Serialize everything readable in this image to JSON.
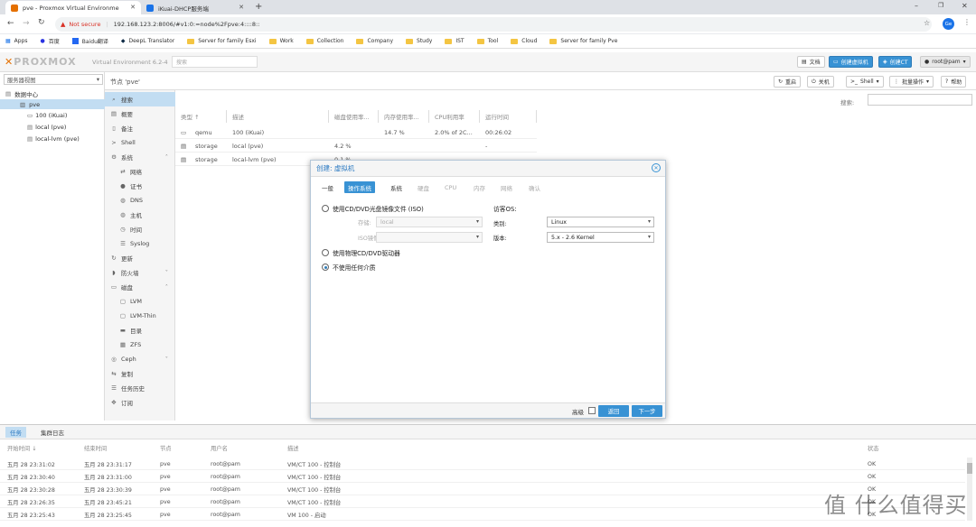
{
  "browser": {
    "tabs": [
      {
        "title": "pve - Proxmox Virtual Environme"
      },
      {
        "title": "iKuai-DHCP服务端"
      }
    ],
    "address": {
      "security": "Not secure",
      "url": "192.168.123.2:8006/#v1:0:=node%2Fpve:4::::8::"
    },
    "profile": "Ge",
    "bookmarks": [
      "Apps",
      "百度",
      "Baidu翻译",
      "DeepL Translator",
      "Server for family Esxi",
      "Work",
      "Collection",
      "Company",
      "Study",
      "IST",
      "Tool",
      "Cloud",
      "Server for family Pve"
    ]
  },
  "pve": {
    "logo": "PROXMOX",
    "version": "Virtual Environment 6.2-4",
    "search_placeholder": "搜索",
    "header_buttons": {
      "docs": "文档",
      "create_vm": "创建虚拟机",
      "create_ct": "创建CT",
      "user": "root@pam"
    },
    "tree": {
      "view_select": "服务器视图",
      "datacenter": "数据中心",
      "node": "pve",
      "children": [
        "100 (iKuai)",
        "local (pve)",
        "local-lvm (pve)"
      ]
    },
    "node_title": "节点 'pve'",
    "node_buttons": {
      "reboot": "重启",
      "shutdown": "关机",
      "shell": "Shell",
      "bulk": "批量操作",
      "help": "帮助"
    },
    "search_label": "搜索:",
    "nav": [
      "搜索",
      "概要",
      "备注",
      "Shell",
      "系统",
      "网络",
      "证书",
      "DNS",
      "主机",
      "时间",
      "Syslog",
      "更新",
      "防火墙",
      "磁盘",
      "LVM",
      "LVM-Thin",
      "目录",
      "ZFS",
      "Ceph",
      "复制",
      "任务历史",
      "订阅"
    ],
    "table": {
      "headers": [
        "类型 ↑",
        "描述",
        "磁盘使用率...",
        "内存使用率...",
        "CPU利用率",
        "运行时间"
      ],
      "rows": [
        {
          "type": "qemu",
          "desc": "100 (iKuai)",
          "disk": "",
          "mem": "14.7 %",
          "cpu": "2.0% of 2C...",
          "uptime": "00:26:02"
        },
        {
          "type": "storage",
          "desc": "local (pve)",
          "disk": "4.2 %",
          "mem": "",
          "cpu": "",
          "uptime": "-"
        },
        {
          "type": "storage",
          "desc": "local-lvm (pve)",
          "disk": "0.1 %",
          "mem": "",
          "cpu": "",
          "uptime": "-"
        }
      ]
    }
  },
  "dialog": {
    "title": "创建: 虚拟机",
    "tabs": [
      "一般",
      "操作系统",
      "系统",
      "硬盘",
      "CPU",
      "内存",
      "网络",
      "确认"
    ],
    "active_tab": "操作系统",
    "option_iso": "使用CD/DVD光盘镜像文件 (ISO)",
    "storage_label": "存储:",
    "storage_value": "local",
    "iso_label": "ISO镜像:",
    "iso_value": "",
    "option_physical": "使用物理CD/DVD驱动器",
    "option_none": "不使用任何介质",
    "guest_os_label": "访客OS:",
    "type_label": "类别:",
    "type_value": "Linux",
    "version_label": "版本:",
    "version_value": "5.x - 2.6 Kernel",
    "advanced_label": "高级",
    "back_button": "返回",
    "next_button": "下一步"
  },
  "log": {
    "tabs": [
      "任务",
      "集群日志"
    ],
    "headers": [
      "开始时间 ↓",
      "结束时间",
      "节点",
      "用户名",
      "描述",
      "状态"
    ],
    "rows": [
      {
        "start": "五月 28 23:31:02",
        "end": "五月 28 23:31:17",
        "node": "pve",
        "user": "root@pam",
        "desc": "VM/CT 100 - 控制台",
        "status": "OK"
      },
      {
        "start": "五月 28 23:30:40",
        "end": "五月 28 23:31:00",
        "node": "pve",
        "user": "root@pam",
        "desc": "VM/CT 100 - 控制台",
        "status": "OK"
      },
      {
        "start": "五月 28 23:30:28",
        "end": "五月 28 23:30:39",
        "node": "pve",
        "user": "root@pam",
        "desc": "VM/CT 100 - 控制台",
        "status": "OK"
      },
      {
        "start": "五月 28 23:26:35",
        "end": "五月 28 23:45:21",
        "node": "pve",
        "user": "root@pam",
        "desc": "VM/CT 100 - 控制台",
        "status": "OK"
      },
      {
        "start": "五月 28 23:25:43",
        "end": "五月 28 23:25:45",
        "node": "pve",
        "user": "root@pam",
        "desc": "VM 100 - 启动",
        "status": "OK"
      }
    ]
  },
  "watermark": "值 什么值得买",
  "colors": {
    "accent": "#3892d4",
    "selected": "#c2ddf2",
    "warning": "#d93025"
  }
}
